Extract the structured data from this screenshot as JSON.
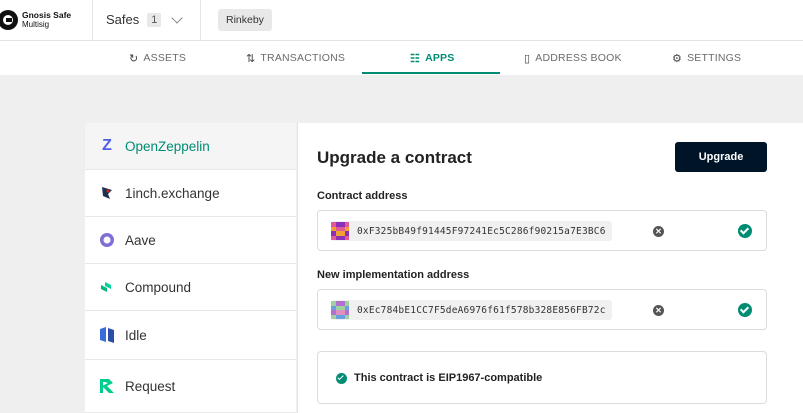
{
  "header": {
    "logo_line1": "Gnosis Safe",
    "logo_line2": "Multisig",
    "safes_label": "Safes",
    "safes_count": "1",
    "network": "Rinkeby"
  },
  "tabs": [
    {
      "label": "ASSETS",
      "icon": "assets-icon"
    },
    {
      "label": "TRANSACTIONS",
      "icon": "transactions-icon"
    },
    {
      "label": "APPS",
      "icon": "apps-icon",
      "active": true
    },
    {
      "label": "ADDRESS BOOK",
      "icon": "address-book-icon"
    },
    {
      "label": "SETTINGS",
      "icon": "settings-icon"
    }
  ],
  "sidebar": {
    "items": [
      {
        "label": "OpenZeppelin",
        "icon": "openzeppelin-icon",
        "active": true
      },
      {
        "label": "1inch.exchange",
        "icon": "1inch-icon"
      },
      {
        "label": "Aave",
        "icon": "aave-icon"
      },
      {
        "label": "Compound",
        "icon": "compound-icon"
      },
      {
        "label": "Idle",
        "icon": "idle-icon"
      },
      {
        "label": "Request",
        "icon": "request-icon"
      }
    ]
  },
  "panel": {
    "title": "Upgrade a contract",
    "upgrade_label": "Upgrade",
    "contract_label": "Contract address",
    "contract_address": "0xF325bB49f91445F97241Ec5C286f90215a7E3BC6",
    "impl_label": "New implementation address",
    "impl_address": "0xEc784bE1CC7F5deA6976f61f578b328E856FB72c",
    "compat_text": "This contract is EIP1967-compatible"
  },
  "colors": {
    "accent": "#008c73",
    "button": "#001428"
  }
}
